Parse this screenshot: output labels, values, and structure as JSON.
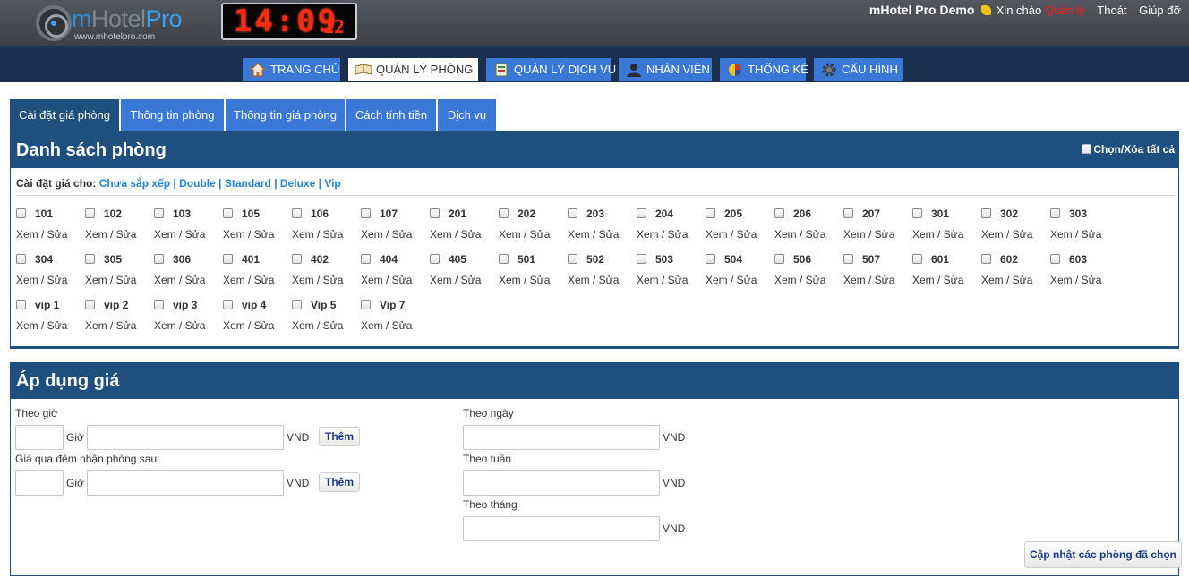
{
  "header": {
    "logo_m": "m",
    "logo_hotel": "Hotel",
    "logo_pro": "Pro",
    "logo_url": "www.mhotelpro.com",
    "clock_hm": "14:09",
    "clock_sec": "12",
    "app_name": "mHotel Pro Demo",
    "greeting": "Xin chào",
    "username": "Quản lý",
    "logout": "Thoát",
    "help": "Giúp đỡ"
  },
  "nav": [
    {
      "label": "TRANG CHỦ",
      "icon": "home-icon"
    },
    {
      "label": "QUẢN LÝ PHÒNG",
      "icon": "book-icon"
    },
    {
      "label": "QUẢN LÝ DỊCH VỤ",
      "icon": "service-icon"
    },
    {
      "label": "NHÂN VIÊN",
      "icon": "user-icon"
    },
    {
      "label": "THỐNG KÊ",
      "icon": "pie-chart-icon"
    },
    {
      "label": "CẤU HÌNH",
      "icon": "gear-icon"
    }
  ],
  "tabs": [
    "Cài đặt giá phòng",
    "Thông tin phòng",
    "Thông tin giá phòng",
    "Cách tính tiền",
    "Dịch vụ"
  ],
  "rooms_panel": {
    "title": "Danh sách phòng",
    "check_all": "Chọn/Xóa tất cả",
    "filter_label": "Cài đặt giá cho:",
    "filters": [
      "Chưa sắp xếp",
      "Double",
      "Standard",
      "Deluxe",
      "Vip"
    ],
    "room_link": "Xem / Sửa",
    "rooms": [
      "101",
      "102",
      "103",
      "105",
      "106",
      "107",
      "201",
      "202",
      "203",
      "204",
      "205",
      "206",
      "207",
      "301",
      "302",
      "303",
      "304",
      "305",
      "306",
      "401",
      "402",
      "404",
      "405",
      "501",
      "502",
      "503",
      "504",
      "506",
      "507",
      "601",
      "602",
      "603",
      "vip 1",
      "vip 2",
      "vip 3",
      "vip 4",
      "Vip 5",
      "Vip 7"
    ]
  },
  "price_panel": {
    "title": "Áp dụng giá",
    "hourly_label": "Theo giờ",
    "hour_unit": "Giờ",
    "currency": "VND",
    "add_button": "Thêm",
    "overnight_label": "Giá qua đêm nhận phòng sau:",
    "daily_label": "Theo ngày",
    "weekly_label": "Theo tuần",
    "monthly_label": "Theo tháng",
    "update_button": "Cập nhật các phòng đã chọn"
  },
  "colors": {
    "header_bg": "#47494f",
    "nav_bg": "#1b2f4f",
    "nav_item": "#3a78d8",
    "panel_head": "#1e4f7e",
    "link": "#2a82d4",
    "username": "#ff1a1a",
    "clock_digits": "#ff2a12"
  }
}
